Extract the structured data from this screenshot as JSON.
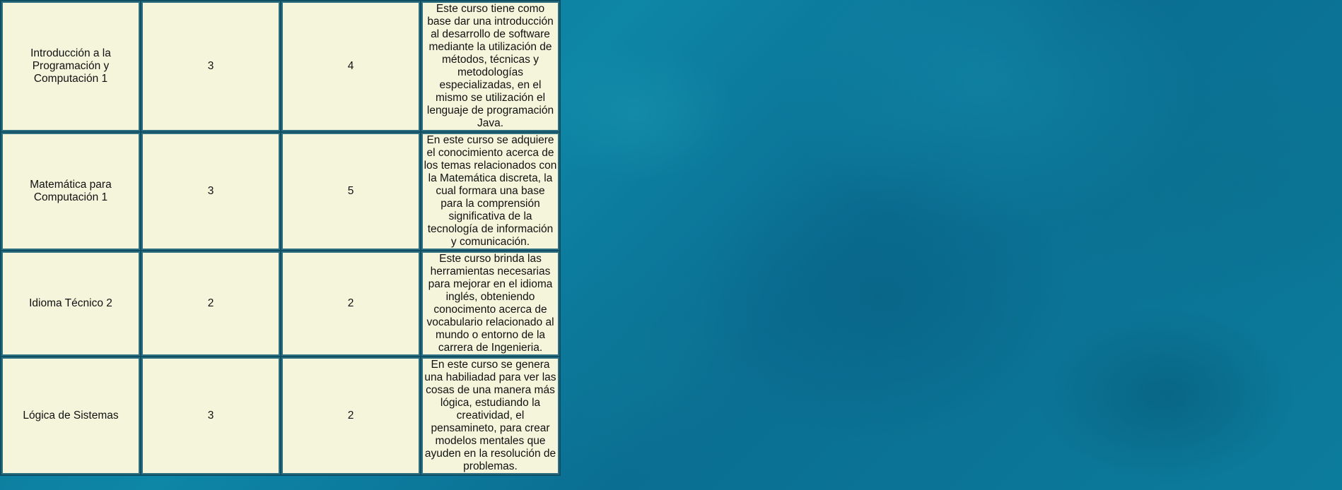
{
  "courses": [
    {
      "name": "Introducción a la Programación y Computación 1",
      "credits": "3",
      "semester": "4",
      "description": "Este curso tiene como base dar una introducción al desarrollo de software mediante la utilización de métodos, técnicas y metodologías especializadas, en el mismo se utilización el lenguaje de programación Java."
    },
    {
      "name": "Matemática para Computación 1",
      "credits": "3",
      "semester": "5",
      "description": "En este curso se adquiere el conocimiento acerca de los temas relacionados con la Matemática discreta, la cual formara una base para la comprensión significativa de la tecnología de información y comunicación."
    },
    {
      "name": "Idioma Técnico 2",
      "credits": "2",
      "semester": "2",
      "description": "Este curso brinda las herramientas necesarias para mejorar en el idioma inglés, obteniendo conocimento acerca de vocabulario relacionado al mundo o entorno de la carrera de Ingenieria."
    },
    {
      "name": "Lógica de Sistemas",
      "credits": "3",
      "semester": "2",
      "description": "En este curso se genera una habiliadad para ver las cosas de una manera más lógica, estudiando la creatividad, el pensamineto, para crear modelos mentales que ayuden en la resolución de problemas."
    }
  ],
  "colors": {
    "cell_background": "#f5f5dc",
    "cell_border": "#2f6f82",
    "page_background": "#0b7a9a"
  }
}
